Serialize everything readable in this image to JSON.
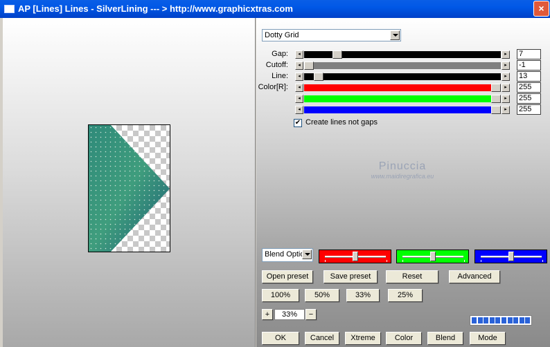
{
  "window": {
    "title": "AP [Lines]  Lines - SilverLining      --- > http://www.graphicxtras.com",
    "close_label": "×"
  },
  "preset_dropdown": {
    "selected": "Dotty Grid"
  },
  "params": [
    {
      "label": "Gap:",
      "value": "7",
      "track_color": "#000000",
      "level": 0.15
    },
    {
      "label": "Cutoff:",
      "value": "-1",
      "track_color": "#808080",
      "level": 0.0
    },
    {
      "label": "Line:",
      "value": "13",
      "track_color": "#000000",
      "level": 0.05
    },
    {
      "label": "Color[R]:",
      "value": "255",
      "track_color": "#ff0000",
      "level": 1.0
    },
    {
      "label": "",
      "value": "255",
      "track_color": "#00ff00",
      "level": 1.0
    },
    {
      "label": "",
      "value": "255",
      "track_color": "#0000ff",
      "level": 1.0
    }
  ],
  "checkbox": {
    "label": "Create lines not gaps",
    "checked": true,
    "mark": "✔"
  },
  "watermark": {
    "line1": "Pinuccia",
    "line2": "www.maidiregrafica.eu"
  },
  "blend_dropdown": {
    "selected": "Blend Optio"
  },
  "channel_bars": [
    {
      "color": "#ff0000",
      "level": 0.5
    },
    {
      "color": "#00ff00",
      "level": 0.5
    },
    {
      "color": "#0000ff",
      "level": 0.5
    }
  ],
  "buttons_row1": [
    "Open preset",
    "Save preset",
    "Reset",
    "Advanced"
  ],
  "zoom_buttons": [
    "100%",
    "50%",
    "33%",
    "25%"
  ],
  "zoom": {
    "plus": "+",
    "value": "33%",
    "minus": "−"
  },
  "progress_segments": 10,
  "bottom_buttons": [
    "OK",
    "Cancel",
    "Xtreme",
    "Color",
    "Blend",
    "Mode"
  ]
}
